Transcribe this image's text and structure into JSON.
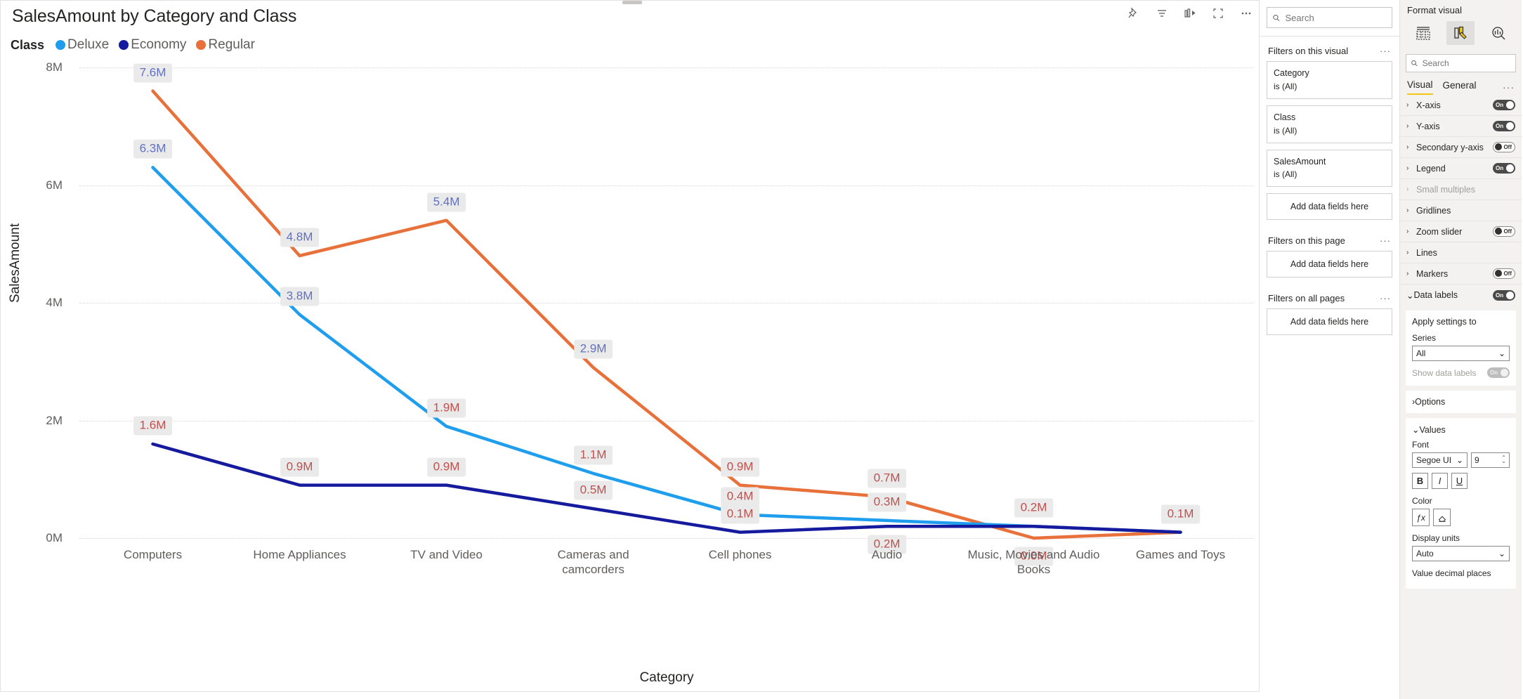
{
  "visual": {
    "title": "SalesAmount by Category and Class",
    "toolbar": [
      {
        "name": "pin-icon",
        "label": "Pin"
      },
      {
        "name": "filter-icon",
        "label": "Filters"
      },
      {
        "name": "drill-icon",
        "label": "Drill"
      },
      {
        "name": "focus-mode-icon",
        "label": "Focus mode"
      },
      {
        "name": "more-options-icon",
        "label": "More options"
      }
    ],
    "legend_title": "Class"
  },
  "chart_data": {
    "type": "line",
    "title": "SalesAmount by Category and Class",
    "xlabel": "Category",
    "ylabel": "SalesAmount",
    "ylim": [
      0,
      8000000
    ],
    "yticks": [
      "0M",
      "2M",
      "4M",
      "6M",
      "8M"
    ],
    "ytick_values": [
      0,
      2000000,
      4000000,
      6000000,
      8000000
    ],
    "grid": true,
    "legend_position": "top-left",
    "categories": [
      "Computers",
      "Home Appliances",
      "TV and Video",
      "Cameras and camcorders",
      "Cell phones",
      "Audio",
      "Music, Movies and Audio Books",
      "Games and Toys"
    ],
    "series": [
      {
        "name": "Deluxe",
        "color": "#1f9eee",
        "values": [
          6300000,
          3800000,
          1900000,
          1100000,
          400000,
          300000,
          200000,
          100000
        ],
        "labels": [
          "6.3M",
          "3.8M",
          "1.9M",
          "1.1M",
          "0.4M",
          "0.3M",
          "0.2M",
          "0.1M"
        ]
      },
      {
        "name": "Economy",
        "color": "#161b9e",
        "values": [
          1600000,
          900000,
          900000,
          500000,
          100000,
          200000,
          200000,
          100000
        ],
        "labels": [
          "1.6M",
          "0.9M",
          "0.9M",
          "0.5M",
          "0.1M",
          "0.2M",
          "0.2M",
          "0.1M"
        ]
      },
      {
        "name": "Regular",
        "color": "#e8703a",
        "values": [
          7600000,
          4800000,
          5400000,
          2900000,
          900000,
          700000,
          0,
          100000
        ],
        "labels": [
          "7.6M",
          "4.8M",
          "5.4M",
          "2.9M",
          "0.9M",
          "0.7M",
          "0.0M",
          "0.1M"
        ]
      }
    ]
  },
  "filters": {
    "search_placeholder": "Search",
    "sections": [
      {
        "heading": "Filters on this visual",
        "cards": [
          {
            "field": "Category",
            "state": "is (All)"
          },
          {
            "field": "Class",
            "state": "is (All)"
          },
          {
            "field": "SalesAmount",
            "state": "is (All)"
          }
        ],
        "dropzone": "Add data fields here"
      },
      {
        "heading": "Filters on this page",
        "cards": [],
        "dropzone": "Add data fields here"
      },
      {
        "heading": "Filters on all pages",
        "cards": [],
        "dropzone": "Add data fields here"
      }
    ]
  },
  "format": {
    "title": "Format visual",
    "icons": [
      {
        "name": "build-visual-icon",
        "active": false
      },
      {
        "name": "format-visual-icon",
        "active": true
      },
      {
        "name": "analytics-icon",
        "active": false
      }
    ],
    "search_placeholder": "Search",
    "tabs": [
      {
        "label": "Visual",
        "active": true
      },
      {
        "label": "General",
        "active": false
      }
    ],
    "tab_overflow": "···",
    "rows": [
      {
        "label": "X-axis",
        "toggle": "On",
        "state": "on",
        "expanded": false,
        "disabled": false
      },
      {
        "label": "Y-axis",
        "toggle": "On",
        "state": "on",
        "expanded": false,
        "disabled": false
      },
      {
        "label": "Secondary y-axis",
        "toggle": "Off",
        "state": "off",
        "expanded": false,
        "disabled": false
      },
      {
        "label": "Legend",
        "toggle": "On",
        "state": "on",
        "expanded": false,
        "disabled": false
      },
      {
        "label": "Small multiples",
        "toggle": "",
        "state": "none",
        "expanded": false,
        "disabled": true
      },
      {
        "label": "Gridlines",
        "toggle": "",
        "state": "none",
        "expanded": false,
        "disabled": false
      },
      {
        "label": "Zoom slider",
        "toggle": "Off",
        "state": "off",
        "expanded": false,
        "disabled": false
      },
      {
        "label": "Lines",
        "toggle": "",
        "state": "none",
        "expanded": false,
        "disabled": false
      },
      {
        "label": "Markers",
        "toggle": "Off",
        "state": "off",
        "expanded": false,
        "disabled": false
      }
    ],
    "data_labels": {
      "label": "Data labels",
      "toggle": "On",
      "apply_settings_to": "Apply settings to",
      "series_label": "Series",
      "series_value": "All",
      "show_data_labels_label": "Show data labels",
      "show_data_labels_toggle": "On",
      "options_label": "Options",
      "values_label": "Values",
      "font_label": "Font",
      "font_family": "Segoe UI",
      "font_size": "9",
      "bold": "B",
      "italic": "I",
      "underline": "U",
      "color_label": "Color",
      "fx_label": "ƒx",
      "display_units_label": "Display units",
      "display_units_value": "Auto",
      "decimal_places_label": "Value decimal places"
    }
  }
}
